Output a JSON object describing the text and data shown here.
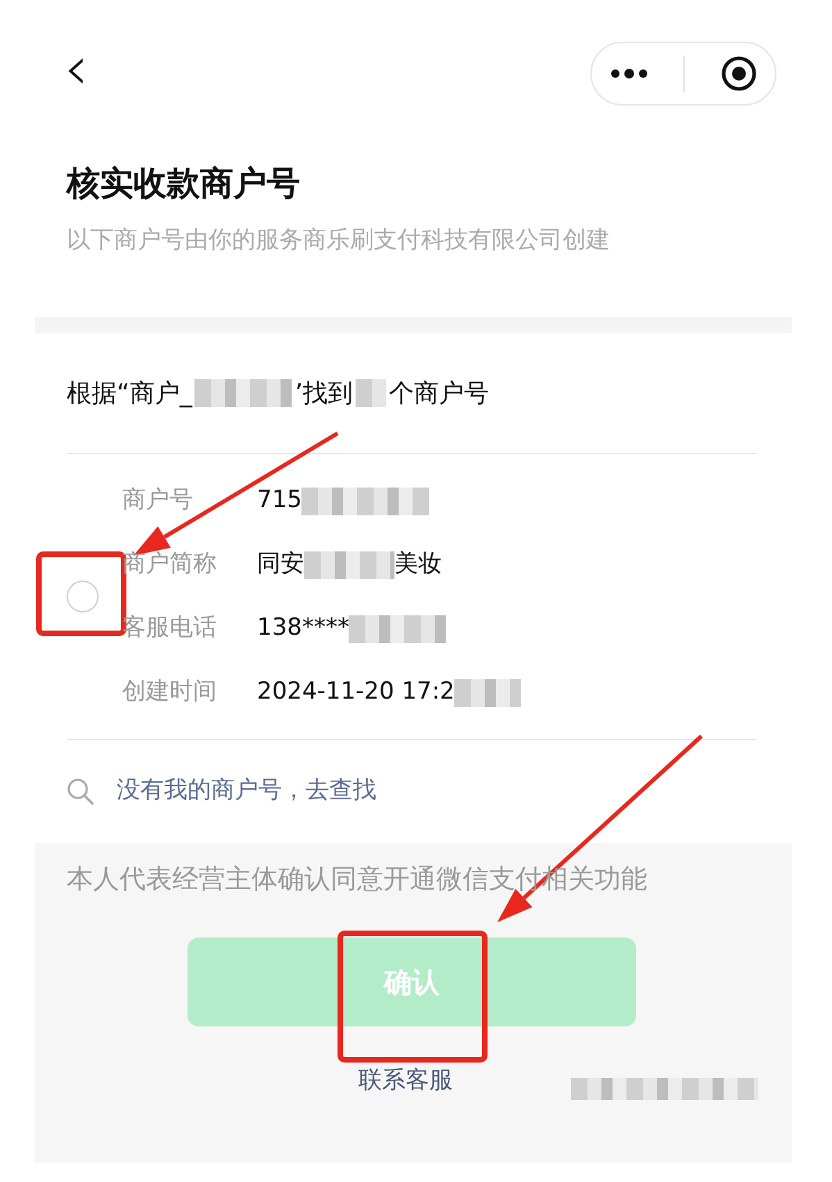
{
  "nav": {
    "back": "‹"
  },
  "header": {
    "title": "核实收款商户号",
    "subtitle": "以下商户号由你的服务商乐刷支付科技有限公司创建"
  },
  "found": {
    "parts": [
      {
        "kind": "text",
        "text": "根据“商户_"
      },
      {
        "kind": "blur"
      },
      {
        "kind": "text",
        "text": "’找到"
      },
      {
        "kind": "blur"
      },
      {
        "kind": "text",
        "text": "个商户号"
      }
    ]
  },
  "merchant": {
    "selected": false,
    "fields": [
      {
        "label": "商户号",
        "value": "715",
        "blurred": true
      },
      {
        "label": "商户简称",
        "value": "同安",
        "blurred": true,
        "suffix": "美妆"
      },
      {
        "label": "客服电话",
        "value": "138****",
        "blurred": true
      },
      {
        "label": "创建时间",
        "value": "2024-11-20 17:2",
        "blurred": true
      }
    ]
  },
  "search_link": "没有我的商户号，去查找",
  "agreement": "本人代表经营主体确认同意开通微信支付相关功能",
  "confirm_button": {
    "label": "确认",
    "disabled": true
  },
  "contact_link": "联系客服",
  "annotations": [
    {
      "kind": "arrow"
    },
    {
      "kind": "box"
    },
    {
      "kind": "arrow"
    },
    {
      "kind": "box"
    }
  ]
}
